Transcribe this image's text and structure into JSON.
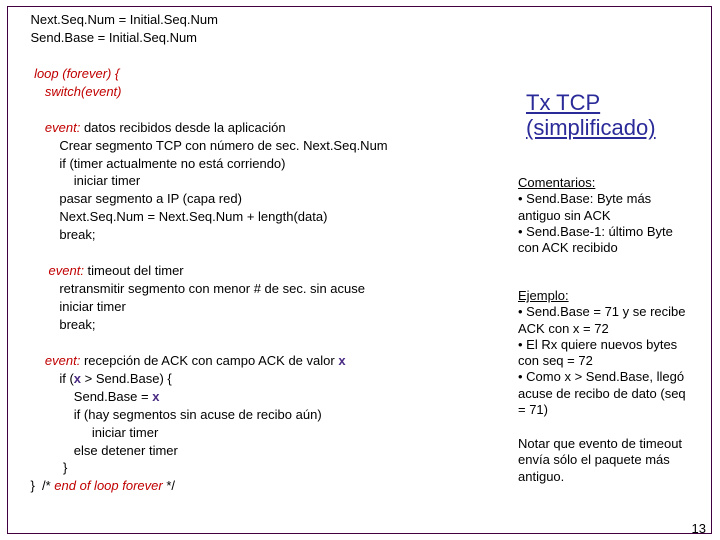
{
  "code": {
    "l1a": "    Next.Seq.Num = Initial.Seq.Num",
    "l1b": "    Send.Base = Initial.Seq.Num",
    "blank1": "",
    "l2a_pre": "     ",
    "l2a_kw": "loop (forever) {",
    "l2b_pre": "        ",
    "l2b_kw": "switch(event)",
    "blank2": "",
    "l3a_pre": "        ",
    "l3a_kw": "event:",
    "l3a_post": " datos recibidos desde la aplicación",
    "l3b": "            Crear segmento TCP con número de sec. Next.Seq.Num",
    "l3c": "            if (timer actualmente no está corriendo)",
    "l3d": "                iniciar timer",
    "l3e": "            pasar segmento a IP (capa red)",
    "l3f": "            Next.Seq.Num = Next.Seq.Num + length(data)",
    "l3g": "            break;",
    "blank3": "",
    "l4a_pre": "         ",
    "l4a_kw": "event:",
    "l4a_post": " timeout del timer",
    "l4b": "            retransmitir segmento con menor # de sec. sin acuse",
    "l4c": "            iniciar timer",
    "l4d": "            break;",
    "blank4": "",
    "l5a_pre": "        ",
    "l5a_kw": "event:",
    "l5a_post1": " recepción de ACK con campo ACK de valor ",
    "l5a_var": "x",
    "l5b_pre": "            if (",
    "l5b_var": "x",
    "l5b_post": " > Send.Base) {",
    "l5c_pre": "                Send.Base = ",
    "l5c_var": "x",
    "l5d": "                if (hay segmentos sin acuse de recibo aún)",
    "l5e": "                     iniciar timer",
    "l5f": "                else detener timer",
    "l5g": "             }",
    "l6a": "    }  /* ",
    "l6a_kw": "end of loop forever",
    "l6a_post": " */"
  },
  "title": {
    "l1": "Tx TCP",
    "l2": "(simplificado)"
  },
  "comments": {
    "head": "Comentarios:",
    "b1": "• Send.Base: Byte más antiguo sin ACK",
    "b2": "• Send.Base-1: último Byte con ACK recibido"
  },
  "example": {
    "head": "Ejemplo:",
    "b1": "• Send.Base = 71 y se recibe ACK con x = 72",
    "b2": "• El Rx quiere nuevos bytes con seq = 72",
    "b3": "• Como x > Send.Base, llegó acuse de recibo de dato (seq = 71)"
  },
  "note": "Notar que evento de timeout envía sólo el paquete más antiguo.",
  "pagenum": "13"
}
